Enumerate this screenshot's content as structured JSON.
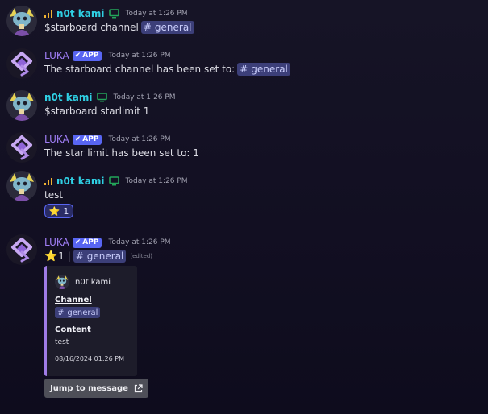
{
  "messages": [
    {
      "author": "n0t kami",
      "timestamp": "Today at 1:26 PM",
      "text": "$starboard channel",
      "channel": "general"
    },
    {
      "author": "LUKA",
      "badge": "APP",
      "timestamp": "Today at 1:26 PM",
      "text": "The starboard channel has been set to:",
      "channel": "general"
    },
    {
      "author": "n0t kami",
      "timestamp": "Today at 1:26 PM",
      "text": "$starboard starlimit 1"
    },
    {
      "author": "LUKA",
      "badge": "APP",
      "timestamp": "Today at 1:26 PM",
      "text": "The star limit has been set to: 1"
    },
    {
      "author": "n0t kami",
      "timestamp": "Today at 1:26 PM",
      "text": "test",
      "reaction": {
        "emoji": "⭐",
        "count": "1"
      }
    },
    {
      "author": "LUKA",
      "badge": "APP",
      "timestamp": "Today at 1:26 PM",
      "star_count": "1 |",
      "channel": "general",
      "edited": "(edited)"
    }
  ],
  "embed": {
    "author_name": "n0t kami",
    "field1_name": "Channel",
    "field1_channel": "general",
    "field2_name": "Content",
    "field2_value": "test",
    "footer": "08/16/2024 01:26 PM",
    "accent_color": "#9f7be6"
  },
  "jump_button": {
    "label": "Jump to message"
  },
  "colors": {
    "user_name": "#2fd0e4",
    "bot_name": "#a07ef6",
    "app_badge": "#5865f2",
    "mention_bg": "#3c3f79"
  },
  "icons": {
    "signal": "signal-bars-icon",
    "monitor": "desktop-icon",
    "check": "verified-check-icon",
    "external": "external-link-icon"
  }
}
